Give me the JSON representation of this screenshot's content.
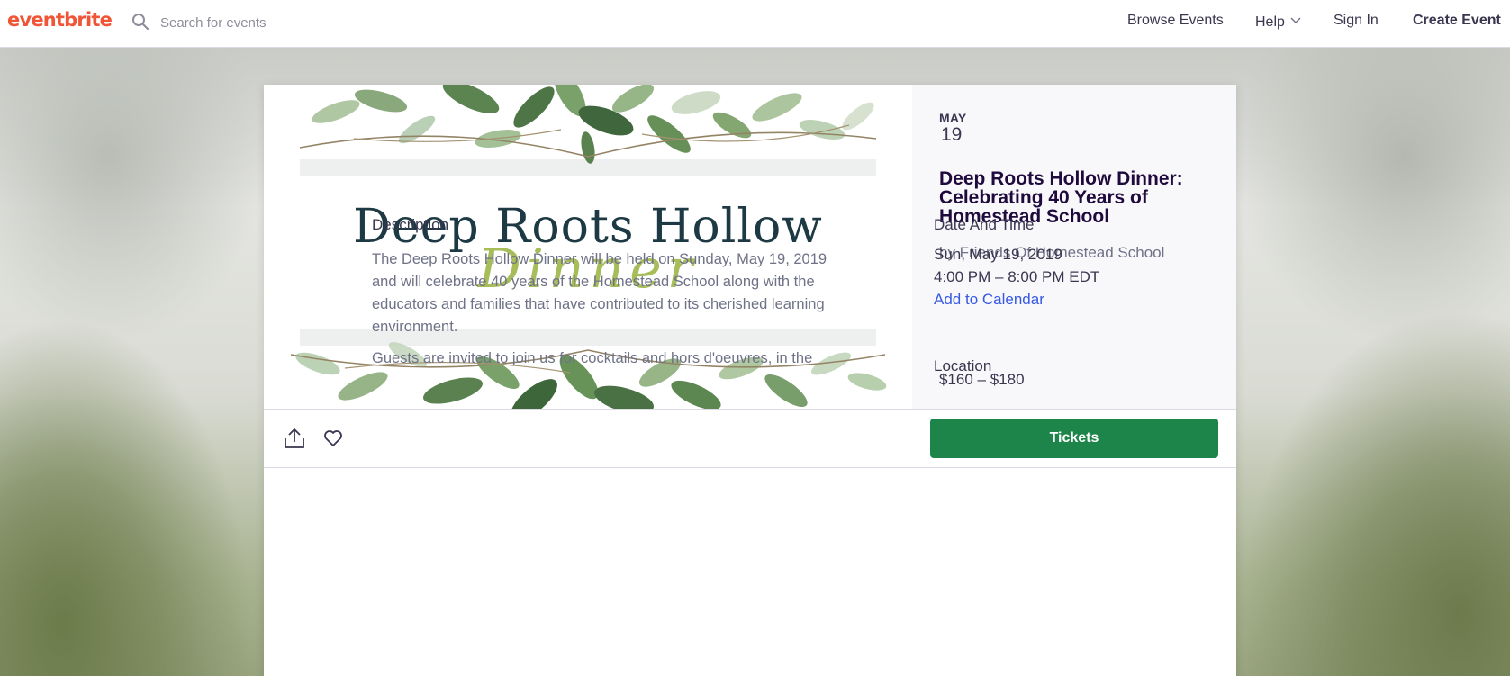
{
  "brand": {
    "logo_text": "eventbrite",
    "accent_color": "#f05537"
  },
  "nav": {
    "search_placeholder": "Search for events",
    "browse": "Browse Events",
    "help": "Help",
    "sign_in": "Sign In",
    "create": "Create Event"
  },
  "hero": {
    "title": "Deep Roots Hollow",
    "script": "Dinner"
  },
  "event": {
    "month": "MAY",
    "day": "19",
    "title": "Deep Roots Hollow Dinner: Celebrating 40 Years of Homestead School",
    "organizer": "by Friends Of Homestead School",
    "price": "$160 – $180",
    "tickets_label": "Tickets",
    "tickets_color": "#1e854a"
  },
  "description": {
    "heading": "Description",
    "p1": "The Deep Roots Hollow Dinner will be held on Sunday, May 19, 2019 and will celebrate 40 years of the Homestead School along with the educators and families that have contributed to its cherished learning environment.",
    "p2": "Guests are invited to join us for cocktails and hors d'oeuvres, in the"
  },
  "date_time": {
    "heading": "Date And Time",
    "date": "Sun, May 19, 2019",
    "time": "4:00 PM – 8:00 PM EDT",
    "add_calendar": "Add to Calendar",
    "link_color": "#3659e3"
  },
  "location": {
    "heading": "Location"
  },
  "icons": [
    "search-icon",
    "chevron-down-icon",
    "share-icon",
    "heart-icon"
  ]
}
